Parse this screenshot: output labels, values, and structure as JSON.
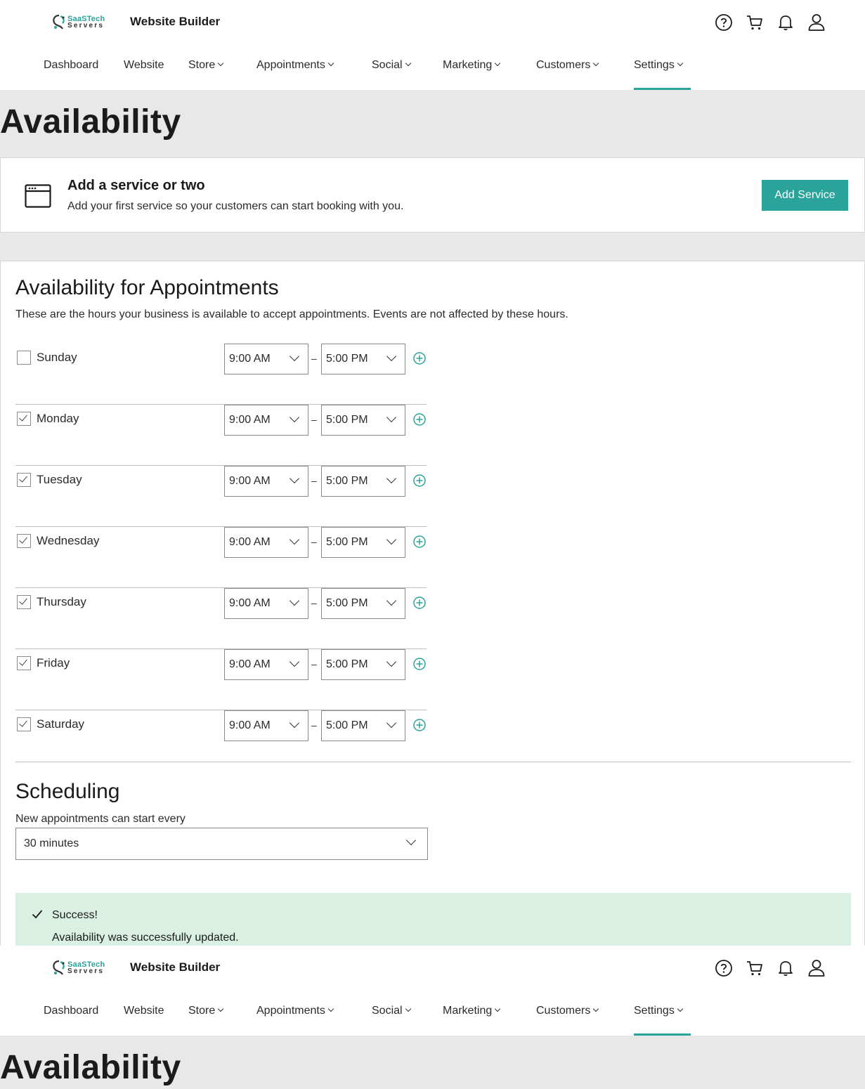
{
  "header": {
    "logo_line1": "SaaSTech",
    "logo_line2": "Servers",
    "app_title": "Website Builder",
    "icons": [
      "help-icon",
      "cart-icon",
      "bell-icon",
      "user-icon"
    ]
  },
  "nav": {
    "items": [
      {
        "label": "Dashboard",
        "dropdown": false
      },
      {
        "label": "Website",
        "dropdown": false
      },
      {
        "label": "Store",
        "dropdown": true
      },
      {
        "label": "Appointments",
        "dropdown": true
      },
      {
        "label": "Social",
        "dropdown": true
      },
      {
        "label": "Marketing",
        "dropdown": true
      },
      {
        "label": "Customers",
        "dropdown": true
      },
      {
        "label": "Settings",
        "dropdown": true,
        "active": true
      }
    ]
  },
  "page": {
    "title": "Availability"
  },
  "promo": {
    "title": "Add a service or two",
    "description": "Add your first service so your customers can start booking with you.",
    "button": "Add Service"
  },
  "availability": {
    "title": "Availability for Appointments",
    "description": "These are the hours your business is available to accept appointments. Events are not affected by these hours.",
    "separator": "–",
    "days": [
      {
        "name": "Sunday",
        "checked": false,
        "start": "9:00 AM",
        "end": "5:00 PM"
      },
      {
        "name": "Monday",
        "checked": true,
        "start": "9:00 AM",
        "end": "5:00 PM"
      },
      {
        "name": "Tuesday",
        "checked": true,
        "start": "9:00 AM",
        "end": "5:00 PM"
      },
      {
        "name": "Wednesday",
        "checked": true,
        "start": "9:00 AM",
        "end": "5:00 PM"
      },
      {
        "name": "Thursday",
        "checked": true,
        "start": "9:00 AM",
        "end": "5:00 PM"
      },
      {
        "name": "Friday",
        "checked": true,
        "start": "9:00 AM",
        "end": "5:00 PM"
      },
      {
        "name": "Saturday",
        "checked": true,
        "start": "9:00 AM",
        "end": "5:00 PM"
      }
    ]
  },
  "scheduling": {
    "title": "Scheduling",
    "label": "New appointments can start every",
    "value": "30 minutes"
  },
  "alert": {
    "title": "Success!",
    "message": "Availability was successfully updated."
  },
  "colors": {
    "accent": "#2aa39a",
    "alert_bg": "#d9f0e2",
    "page_bg": "#e8e8e8"
  }
}
